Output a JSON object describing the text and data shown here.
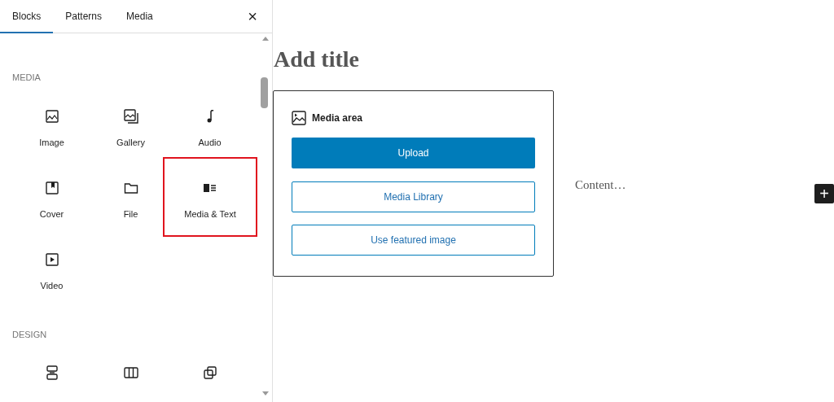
{
  "sidebar": {
    "tabs": [
      {
        "label": "Blocks",
        "selected": true
      },
      {
        "label": "Patterns",
        "selected": false
      },
      {
        "label": "Media",
        "selected": false
      }
    ],
    "close": "×",
    "sections": [
      {
        "heading": "MEDIA",
        "items": [
          {
            "label": "Image",
            "highlighted": false
          },
          {
            "label": "Gallery",
            "highlighted": false
          },
          {
            "label": "Audio",
            "highlighted": false
          },
          {
            "label": "Cover",
            "highlighted": false
          },
          {
            "label": "File",
            "highlighted": false
          },
          {
            "label": "Media & Text",
            "highlighted": true
          },
          {
            "label": "Video",
            "highlighted": false
          }
        ]
      },
      {
        "heading": "DESIGN",
        "items": [
          {
            "highlighted": false
          },
          {
            "highlighted": false
          },
          {
            "highlighted": false
          }
        ]
      }
    ]
  },
  "editor": {
    "title_placeholder": "Add title",
    "media_area": {
      "label": "Media area",
      "buttons": [
        {
          "label": "Upload",
          "kind": "primary"
        },
        {
          "label": "Media Library",
          "kind": "outline"
        },
        {
          "label": "Use featured image",
          "kind": "outline"
        }
      ]
    },
    "content_placeholder": "Content…",
    "add_button": "+"
  }
}
